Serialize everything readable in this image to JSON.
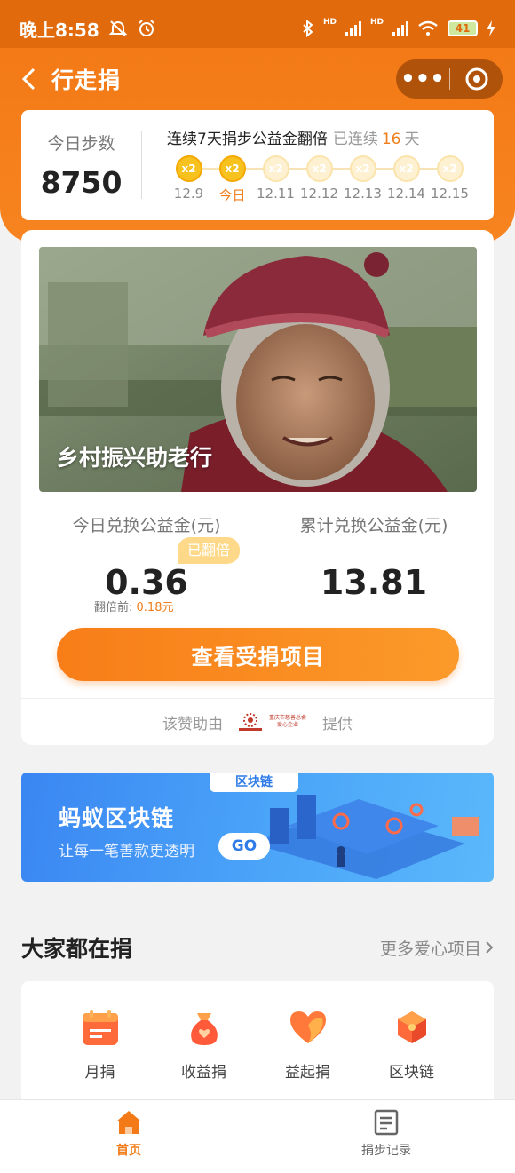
{
  "status_bar": {
    "time": "晚上8:58",
    "network_1": "HD",
    "network_2": "HD",
    "battery": "41"
  },
  "nav": {
    "title": "行走捐",
    "more_label": "•••"
  },
  "steps": {
    "label": "今日步数",
    "value": "8750"
  },
  "streak": {
    "title": "连续7天捐步公益金翻倍",
    "prefix": "已连续",
    "days": "16",
    "suffix": "天",
    "days_list": [
      {
        "badge": "x2",
        "date": "12.9",
        "active": true
      },
      {
        "badge": "x2",
        "date": "今日",
        "active": true
      },
      {
        "badge": "x2",
        "date": "12.11",
        "active": false
      },
      {
        "badge": "x2",
        "date": "12.12",
        "active": false
      },
      {
        "badge": "x2",
        "date": "12.13",
        "active": false
      },
      {
        "badge": "x2",
        "date": "12.14",
        "active": false
      },
      {
        "badge": "x2",
        "date": "12.15",
        "active": false
      }
    ]
  },
  "project": {
    "title": "乡村振兴助老行",
    "today_label": "今日兑换公益金(元)",
    "today_value": "0.36",
    "doubled_badge": "已翻倍",
    "before_label": "翻倍前:",
    "before_value": "0.18元",
    "total_label": "累计兑换公益金(元)",
    "total_value": "13.81",
    "view_button": "查看受捐项目",
    "sponsor_prefix": "该赞助由",
    "sponsor_logo_text": "重庆市慈善总会 爱心企业",
    "sponsor_suffix": "提供"
  },
  "banner": {
    "tag": "区块链",
    "title": "蚂蚁区块链",
    "subtitle": "让每一笔善款更透明",
    "go_label": "GO"
  },
  "section": {
    "title": "大家都在捐",
    "more_label": "更多爱心项目",
    "categories": [
      {
        "label": "月捐",
        "icon": "calendar-icon"
      },
      {
        "label": "收益捐",
        "icon": "money-bag-icon"
      },
      {
        "label": "益起捐",
        "icon": "heart-icon"
      },
      {
        "label": "区块链",
        "icon": "blockchain-cube-icon"
      }
    ]
  },
  "tabbar": {
    "home_label": "首页",
    "records_label": "捐步记录"
  },
  "colors": {
    "brand_orange": "#f37a16",
    "accent_text": "#f07d1a",
    "banner_blue": "#3a86f2"
  }
}
